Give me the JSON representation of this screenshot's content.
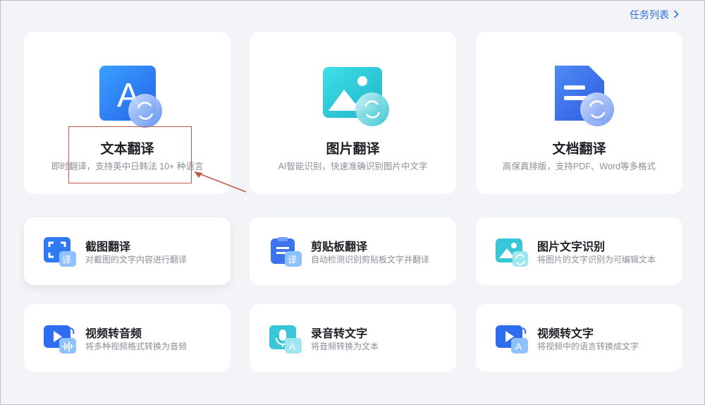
{
  "header": {
    "task_list_label": "任务列表"
  },
  "main_tools": [
    {
      "title": "文本翻译",
      "desc": "即时翻译，支持英中日韩法 10+ 种语言"
    },
    {
      "title": "图片翻译",
      "desc": "AI智能识别，快速准确识别图片中文字"
    },
    {
      "title": "文档翻译",
      "desc": "高保真排版，支持PDF、Word等多格式"
    }
  ],
  "tools": [
    {
      "title": "截图翻译",
      "desc": "对截图的文字内容进行翻译"
    },
    {
      "title": "剪贴板翻译",
      "desc": "自动检测识别剪贴板文字并翻译"
    },
    {
      "title": "图片文字识别",
      "desc": "将图片的文字识别为可编辑文本"
    },
    {
      "title": "视频转音频",
      "desc": "将多种视频格式转换为音频"
    },
    {
      "title": "录音转文字",
      "desc": "将音频转换为文本"
    },
    {
      "title": "视频转文字",
      "desc": "将视频中的语言转换成文字"
    }
  ],
  "icons": {
    "text_translate": "letter-a-refresh-icon",
    "image_translate": "picture-refresh-icon",
    "doc_translate": "document-refresh-icon",
    "screenshot": "screenshot-translate-icon",
    "clipboard": "clipboard-translate-icon",
    "ocr": "image-text-icon",
    "video_audio": "video-to-audio-icon",
    "record_text": "mic-to-text-icon",
    "video_text": "video-to-text-icon"
  },
  "colors": {
    "accent": "#2d6ee6",
    "annotation": "#c0594a"
  }
}
